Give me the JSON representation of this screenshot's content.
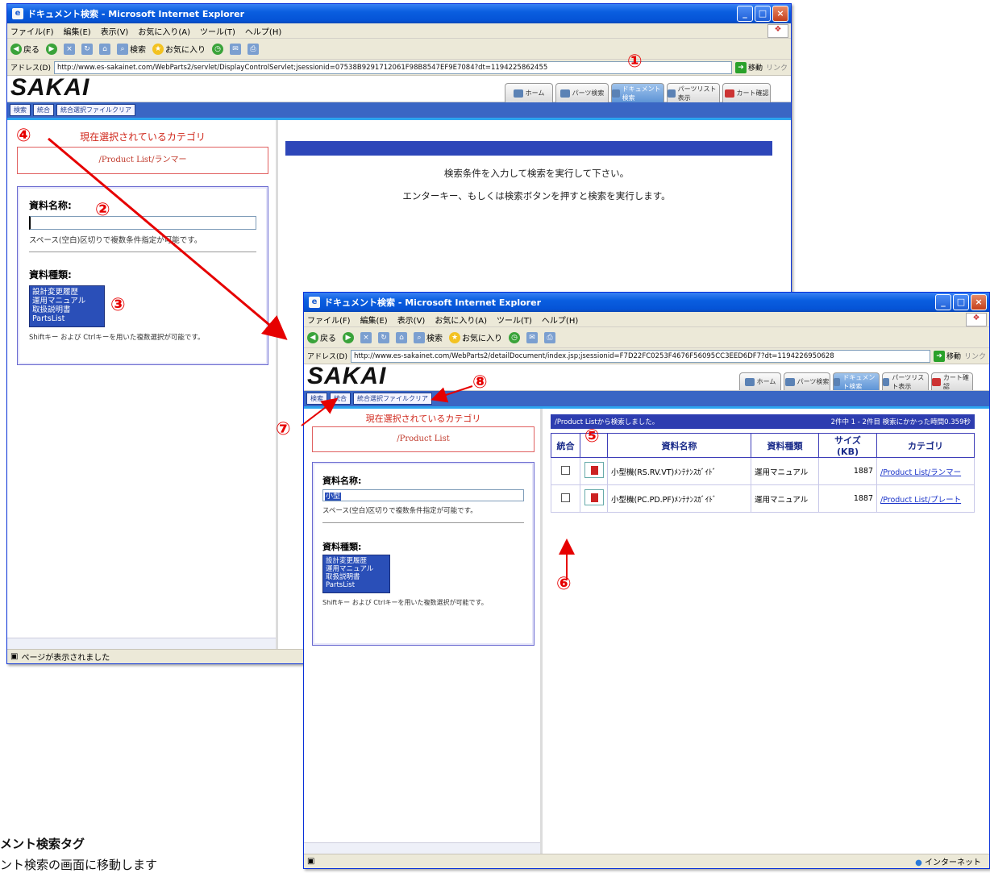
{
  "window1": {
    "title": "ドキュメント検索 - Microsoft Internet Explorer",
    "menu": [
      "ファイル(F)",
      "編集(E)",
      "表示(V)",
      "お気に入り(A)",
      "ツール(T)",
      "ヘルプ(H)"
    ],
    "toolbar": {
      "back": "戻る",
      "search": "検索",
      "favorites": "お気に入り"
    },
    "address_label": "アドレス(D)",
    "address_url": "http://www.es-sakainet.com/WebParts2/servlet/DisplayControlServlet;jsessionid=07538B9291712061F98B8547EF9E7084?dt=1194225862455",
    "go_label": "移動",
    "links_label": "リンク",
    "logo": "SAKAI",
    "tabs": [
      "ホーム",
      "パーツ検索",
      "ドキュメント検索",
      "パーツリスト表示",
      "カート確認"
    ],
    "subbuttons": [
      "検索",
      "統合",
      "統合選択ファイルクリア"
    ],
    "category_title": "現在選択されているカテゴリ",
    "category_value": "/Product List/ランマー",
    "name_label": "資料名称:",
    "name_value": "",
    "name_hint": "スペース(空白)区切りで複数条件指定が可能です。",
    "type_label": "資料種類:",
    "type_options": [
      "設計変更履歴",
      "運用マニュアル",
      "取扱説明書",
      "PartsList"
    ],
    "type_hint": "Shiftキー および Ctrlキーを用いた複数選択が可能です。",
    "message1": "検索条件を入力して検索を実行して下さい。",
    "message2": "エンターキー、もしくは検索ボタンを押すと検索を実行します。",
    "status": "ページが表示されました"
  },
  "window2": {
    "title": "ドキュメント検索 - Microsoft Internet Explorer",
    "menu": [
      "ファイル(F)",
      "編集(E)",
      "表示(V)",
      "お気に入り(A)",
      "ツール(T)",
      "ヘルプ(H)"
    ],
    "toolbar": {
      "back": "戻る",
      "search": "検索",
      "favorites": "お気に入り"
    },
    "address_label": "アドレス(D)",
    "address_url": "http://www.es-sakainet.com/WebParts2/detailDocument/index.jsp;jsessionid=F7D22FC0253F4676F56095CC3EED6DF7?dt=1194226950628",
    "go_label": "移動",
    "links_label": "リンク",
    "logo": "SAKAI",
    "tabs": [
      "ホーム",
      "パーツ検索",
      "ドキュメント検索",
      "パーツリスト表示",
      "カート確認"
    ],
    "subbuttons": [
      "検索",
      "統合",
      "統合選択ファイルクリア"
    ],
    "category_title": "現在選択されているカテゴリ",
    "category_value": "/Product List",
    "name_label": "資料名称:",
    "name_value": "小型",
    "name_hint": "スペース(空白)区切りで複数条件指定が可能です。",
    "type_label": "資料種類:",
    "type_options": [
      "設計変更履歴",
      "運用マニュアル",
      "取扱説明書",
      "PartsList"
    ],
    "type_hint": "Shiftキー および Ctrlキーを用いた複数選択が可能です。",
    "result_header_left": "/Product Listから検索しました。",
    "result_header_right": "2件中 1 - 2件目 検索にかかった時間0.359秒",
    "columns": [
      "統合",
      "",
      "資料名称",
      "資料種類",
      "サイズ(KB)",
      "カテゴリ"
    ],
    "rows": [
      {
        "name": "小型機(RS.RV.VT)ﾒﾝﾃﾅﾝｽｶﾞｲﾄﾞ",
        "type": "運用マニュアル",
        "size": "1887",
        "category": "/Product List/ランマー"
      },
      {
        "name": "小型機(PC.PD.PF)ﾒﾝﾃﾅﾝｽｶﾞｲﾄﾞ",
        "type": "運用マニュアル",
        "size": "1887",
        "category": "/Product List/プレート"
      }
    ],
    "status_zone": "インターネット"
  },
  "markers": [
    "①",
    "②",
    "③",
    "④",
    "⑤",
    "⑥",
    "⑦",
    "⑧"
  ],
  "bottom_text_1": "メント検索タグ",
  "bottom_text_2": "ント検索の画面に移動します",
  "colors": {
    "accent_blue": "#2da4ef",
    "marker_red": "#e60000",
    "xp_title": "#0553d6"
  }
}
